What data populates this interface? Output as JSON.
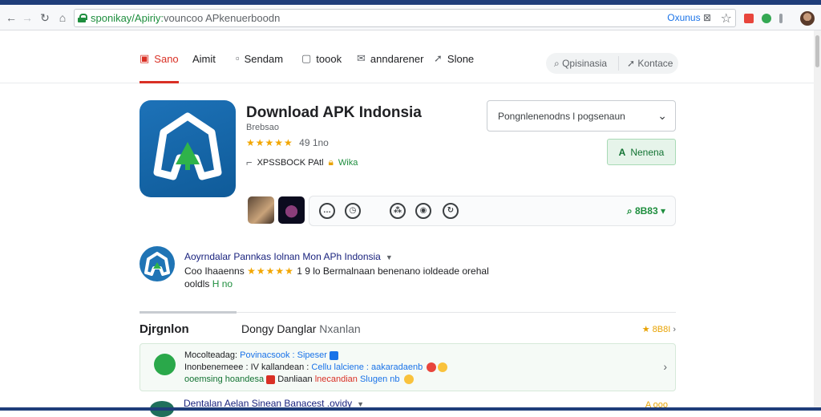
{
  "browser": {
    "url_domain": "sponikay/Apiriy:",
    "url_rest": "vouncoo APkenuerboodn",
    "omni_right_text": "Oxunus",
    "colors": {
      "accent": "#d93025",
      "green": "#1e8e3e",
      "blue": "#1a73e8",
      "brand": "#1d72b8"
    }
  },
  "nav": {
    "tabs": [
      {
        "label": "Sano",
        "icon": "store-icon"
      },
      {
        "label": "Aimit",
        "icon": ""
      },
      {
        "label": "Sendam",
        "icon": "square-icon"
      },
      {
        "label": "toook",
        "icon": "book-icon"
      },
      {
        "label": "anndarener",
        "icon": "mail-icon"
      },
      {
        "label": "Slone",
        "icon": "share-icon"
      }
    ],
    "search_left": "Qpisinasia",
    "search_right": "Kontace"
  },
  "app": {
    "title": "Download APK Indonsia",
    "developer": "Brebsao",
    "stars": "★★★★★",
    "rating_count": "49 1no",
    "info_text": "XPSSBOCK PAtl",
    "info_green": "Wika",
    "version_select": "Pongnlenenodns l pogsenaun",
    "install_label": "Nenena",
    "review_count": "8B83"
  },
  "featured": {
    "title": "Aoyrndalar Pannkas Iolnan Mon APh Indonsia",
    "line2_prefix": "Coo Ihaaenns",
    "stars": "★★★★★",
    "line2_rest": "1 9 lo Bermalnaan benenano ioldeade orehal",
    "line3_prefix": "ooldls",
    "line3_green": "H no"
  },
  "section": {
    "title": "Djrgnlon",
    "subtitle_dark": "Dongy Danglar",
    "subtitle_light": "Nxanlan",
    "right_label": "8B8I"
  },
  "card": {
    "l1_dark": "Mocolteadag:",
    "l1_blue": "Povinacsook : Sipeser",
    "l2_dark": "Inonbenemeee : IV kallandean :",
    "l2_rest": "Cellu lalciene : aakaradaenb",
    "l3_green": "ooemsing hoandesa",
    "l3_red_text": "Danliaan",
    "l3_dark": "lnecandian",
    "l3_blue": "Slugen nb"
  },
  "row2": {
    "title": "Dentalan Aelan Sinean Banacest .ovidy",
    "right": "A ooo"
  }
}
